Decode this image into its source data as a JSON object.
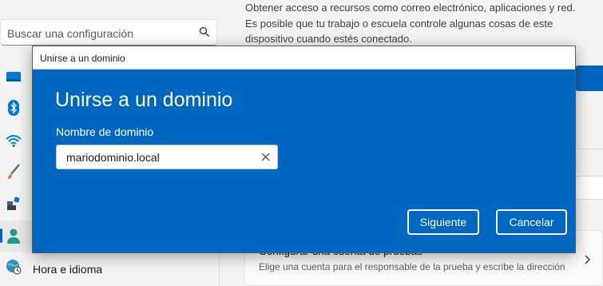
{
  "settings": {
    "search": {
      "placeholder": "Buscar una configuración",
      "icon": "search-icon"
    },
    "nav": {
      "items": [
        {
          "icon": "display-icon",
          "color": "#0078d4"
        },
        {
          "icon": "bluetooth-icon",
          "color": "#0078d4"
        },
        {
          "icon": "wifi-icon",
          "color": "#0078d4"
        },
        {
          "icon": "brush-icon",
          "color": "#e07b39"
        },
        {
          "icon": "apps-icon",
          "color": "#4a5a6a"
        },
        {
          "icon": "account-icon",
          "color": "#1f9b8e",
          "selected": true
        },
        {
          "icon": "globe-clock-icon",
          "label": "Hora e idioma"
        }
      ]
    },
    "info_lines": [
      "Obtener acceso a recursos como correo electrónico, aplicaciones y red.",
      "Es posible que tu trabajo o escuela controle algunas cosas de este",
      "dispositivo cuando estés conectado."
    ],
    "card": {
      "title": "Configurar una cuenta de pruebas",
      "subtitle": "Elige una cuenta para el responsable de la prueba y escribe la dirección"
    }
  },
  "dialog": {
    "window_title": "Unirse a un dominio",
    "heading": "Unirse a un dominio",
    "field_label": "Nombre de dominio",
    "field_value": "mariodominio.local",
    "next_label": "Siguiente",
    "cancel_label": "Cancelar",
    "background_color": "#0067c0"
  }
}
